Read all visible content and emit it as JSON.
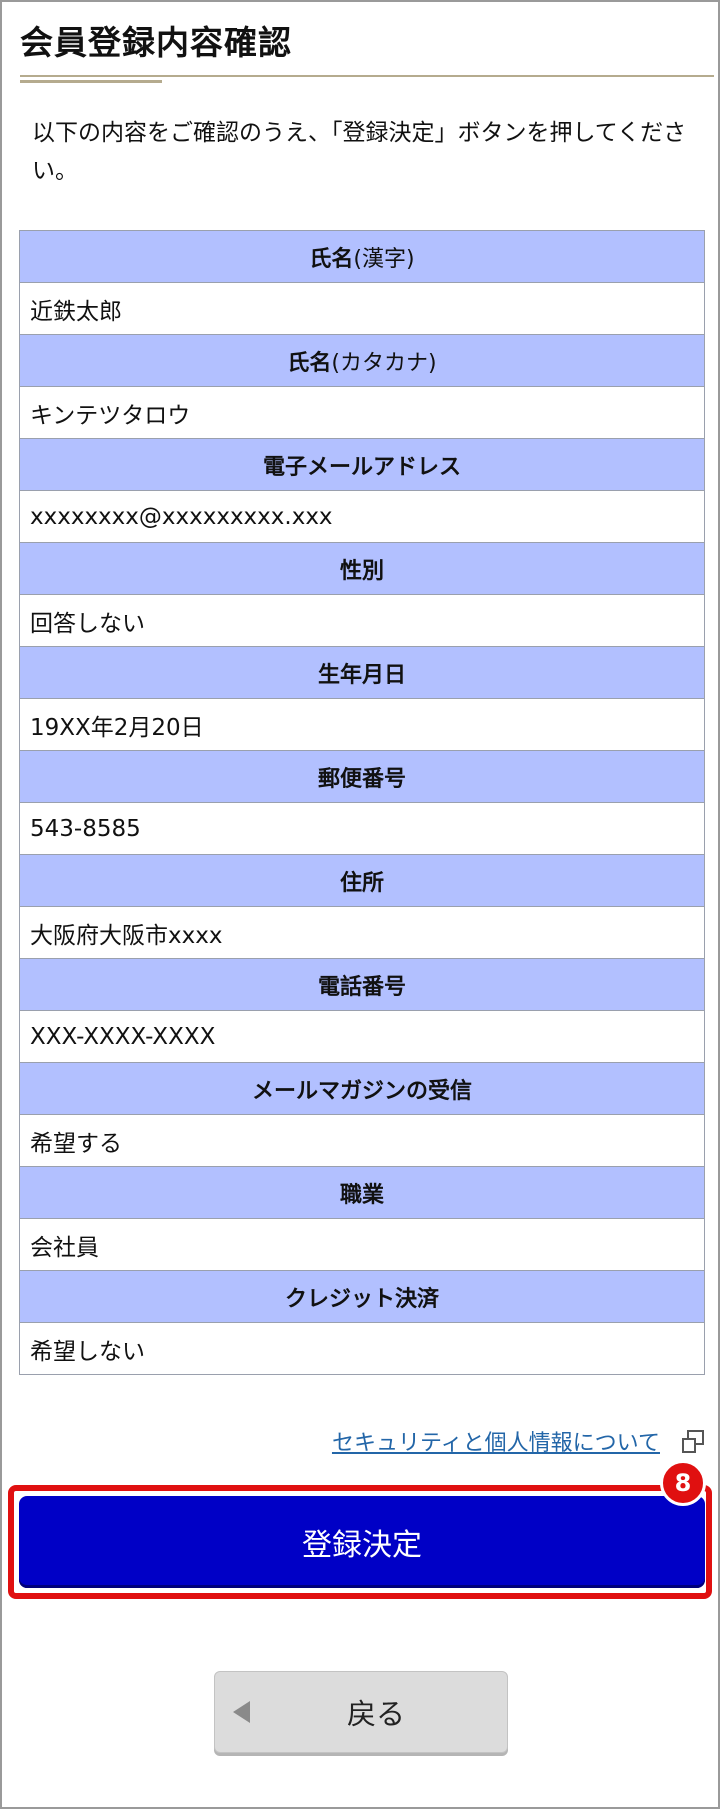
{
  "page_title": "会員登録内容確認",
  "intro_text": "以下の内容をご確認のうえ、「登録決定」ボタンを押してください。",
  "fields": [
    {
      "label": "氏名",
      "label_note": "(漢字)",
      "value": "近鉄太郎"
    },
    {
      "label": "氏名",
      "label_note": "(カタカナ)",
      "value": "キンテツタロウ"
    },
    {
      "label": "電子メールアドレス",
      "label_note": "",
      "value": "xxxxxxxx@xxxxxxxxx.xxx"
    },
    {
      "label": "性別",
      "label_note": "",
      "value": "回答しない"
    },
    {
      "label": "生年月日",
      "label_note": "",
      "value": "19XX年2月20日"
    },
    {
      "label": "郵便番号",
      "label_note": "",
      "value": "543-8585"
    },
    {
      "label": "住所",
      "label_note": "",
      "value": "大阪府大阪市xxxx"
    },
    {
      "label": "電話番号",
      "label_note": "",
      "value": "XXX-XXXX-XXXX"
    },
    {
      "label": "メールマガジンの受信",
      "label_note": "",
      "value": "希望する"
    },
    {
      "label": "職業",
      "label_note": "",
      "value": "会社員"
    },
    {
      "label": "クレジット決済",
      "label_note": "",
      "value": "希望しない"
    }
  ],
  "security_link": "セキュリティと個人情報について",
  "step_badge": "8",
  "submit_label": "登録決定",
  "back_label": "戻る",
  "colors": {
    "header_cell": "#b2c0ff",
    "submit_button": "#0000c6",
    "highlight": "#e01010",
    "link": "#2366a8"
  }
}
